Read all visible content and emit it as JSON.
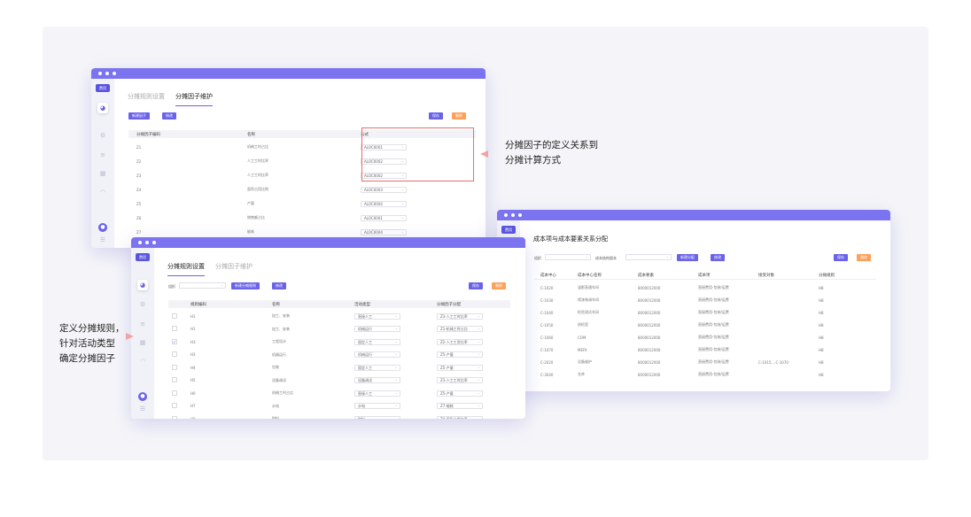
{
  "colors": {
    "accent": "#6a63e8",
    "titlebar": "#7b73f0",
    "orange": "#fda05a",
    "highlight": "#ee6a6a"
  },
  "annotations": {
    "factor_line1": "分摊因子的定义关系到",
    "factor_line2": "分摊计算方式",
    "rule_line1": "定义分摊规则，",
    "rule_line2": "针对活动类型",
    "rule_line3": "确定分摊因子"
  },
  "win1": {
    "logo": "费用",
    "tabs": [
      {
        "label": "分摊规则设置"
      },
      {
        "label": "分摊因子维护"
      }
    ],
    "buttons": {
      "new": "新建因子",
      "edit": "修改",
      "save": "保存",
      "delete": "删除"
    },
    "columns": [
      "分摊因子编码",
      "名称",
      "公式"
    ],
    "rows": [
      {
        "code": "Z1",
        "name": "机械工时占比",
        "formula": "ALOC0001"
      },
      {
        "code": "Z2",
        "name": "人工工时比率",
        "formula": "ALOC0002"
      },
      {
        "code": "Z3",
        "name": "人工工时比率",
        "formula": "ALOC0002"
      },
      {
        "code": "Z4",
        "name": "面积占用比例",
        "formula": "ALOC0003"
      },
      {
        "code": "Z5",
        "name": "产量",
        "formula": "ALOC0004"
      },
      {
        "code": "Z6",
        "name": "销售额占比",
        "formula": "ALOC0001"
      },
      {
        "code": "Z7",
        "name": "能耗",
        "formula": "ALOC0004"
      }
    ]
  },
  "win2": {
    "logo": "费用",
    "tabs": [
      {
        "label": "分摊规则设置"
      },
      {
        "label": "分摊因子维护"
      }
    ],
    "filter_label": "组织",
    "filter_value": "",
    "buttons": {
      "new": "新建分摊规则",
      "edit": "修改",
      "save": "保存",
      "delete": "删除"
    },
    "columns": [
      "规则编码",
      "名称",
      "活动类型",
      "分摊因子分配"
    ],
    "rows": [
      {
        "checked": false,
        "code": "H1",
        "name": "加工、安装",
        "activity": "直接人工",
        "factor": "Z3-人工工时比率"
      },
      {
        "checked": false,
        "code": "H1",
        "name": "加工、安装",
        "activity": "机械运行",
        "factor": "Z1-机械工时占比"
      },
      {
        "checked": true,
        "code": "H3",
        "name": "工程设计",
        "activity": "固定人工",
        "factor": "Z2-人工工资比率"
      },
      {
        "checked": false,
        "code": "H3",
        "name": "机器运行",
        "activity": "机械运行",
        "factor": "Z5-产量"
      },
      {
        "checked": false,
        "code": "H4",
        "name": "包装",
        "activity": "固定人工",
        "factor": "Z5-产量"
      },
      {
        "checked": false,
        "code": "H5",
        "name": "设备调试",
        "activity": "设备调试",
        "factor": "Z3-人工工时比率"
      },
      {
        "checked": false,
        "code": "H0",
        "name": "机械工时占比",
        "activity": "直接人工",
        "factor": "Z5-产量"
      },
      {
        "checked": false,
        "code": "H7",
        "name": "水电",
        "activity": "水电",
        "factor": "Z7-能耗"
      },
      {
        "checked": false,
        "code": "H8",
        "name": "财料",
        "activity": "财料",
        "factor": "Z4-面积占用比率"
      }
    ]
  },
  "win3": {
    "logo": "费用",
    "title": "成本项与成本要素关系分配",
    "filters": {
      "label1": "组织",
      "label2": "成本结构版本"
    },
    "buttons": {
      "new": "新建分配",
      "edit": "修改",
      "save": "保存",
      "delete": "删除"
    },
    "columns": [
      "成本中心",
      "成本中心名称",
      "成本要素",
      "成本项",
      "接受对象",
      "分摊规则"
    ],
    "rows": [
      {
        "center": "C-1020",
        "cname": "温影直通车间",
        "element": "8000012000",
        "item": "直接费用-包装/运费",
        "receiver": "",
        "rule": "H8"
      },
      {
        "center": "C-1030",
        "cname": "喷漆装调车间",
        "element": "8000012000",
        "item": "直接费用-包装/运费",
        "receiver": "",
        "rule": "H8"
      },
      {
        "center": "C-1040",
        "cname": "检验测试车间",
        "element": "8000012000",
        "item": "直接费用-包装/运费",
        "receiver": "",
        "rule": "H8"
      },
      {
        "center": "C-1050",
        "cname": "质检室",
        "element": "8000012000",
        "item": "直接费用-包装/运费",
        "receiver": "",
        "rule": "H8"
      },
      {
        "center": "C-1060",
        "cname": "COM",
        "element": "8000012000",
        "item": "直接费用-包装/运费",
        "receiver": "",
        "rule": "H8"
      },
      {
        "center": "C-1070",
        "cname": "MEFA",
        "element": "8000012000",
        "item": "直接费用-包装/运费",
        "receiver": "",
        "rule": "H8"
      },
      {
        "center": "C-2020",
        "cname": "设备维护",
        "element": "8000012000",
        "item": "直接费用-包装/运费",
        "receiver": "C-1015,...C-1070",
        "rule": "H8"
      },
      {
        "center": "C-3040",
        "cname": "仓库",
        "element": "8000012000",
        "item": "直接费用-包装/运费",
        "receiver": "",
        "rule": "H8"
      }
    ]
  }
}
